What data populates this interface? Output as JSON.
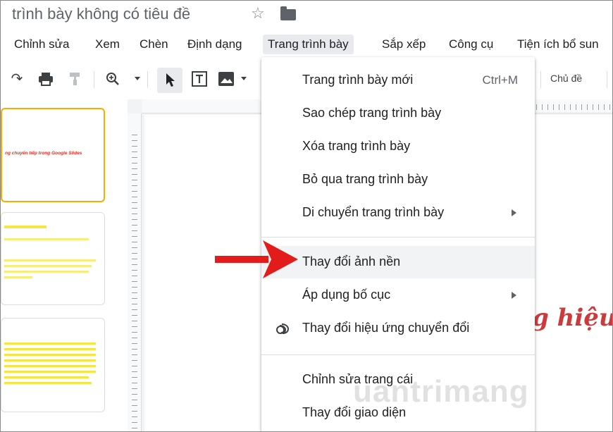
{
  "document": {
    "title": "trình bày không có tiêu đề"
  },
  "menubar": {
    "items": [
      {
        "label": "Chỉnh sửa"
      },
      {
        "label": "Xem"
      },
      {
        "label": "Chèn"
      },
      {
        "label": "Định dạng"
      },
      {
        "label": "Trang trình bày"
      },
      {
        "label": "Sắp xếp"
      },
      {
        "label": "Công cụ"
      },
      {
        "label": "Tiện ích bổ sun"
      }
    ],
    "active_index": 4
  },
  "toolbar": {
    "icons": [
      "redo-icon",
      "print-icon",
      "paint-format-icon",
      "zoom-icon",
      "select-icon",
      "textbox-icon",
      "image-icon"
    ],
    "theme_label": "Chủ đề"
  },
  "filmstrip": {
    "slides": [
      {
        "text": "ng chuyển tiếp trong Google Slides",
        "color": "#d93025"
      },
      {
        "text": "",
        "color": "#f5e642"
      },
      {
        "text": "",
        "color": "#f5e642"
      }
    ]
  },
  "slide": {
    "title_fragment": "g hiệu ứ"
  },
  "dropdown": {
    "items": [
      {
        "label": "Trang trình bày mới",
        "shortcut": "Ctrl+M"
      },
      {
        "label": "Sao chép trang trình bày"
      },
      {
        "label": "Xóa trang trình bày"
      },
      {
        "label": "Bỏ qua trang trình bày"
      },
      {
        "label": "Di chuyển trang trình bày",
        "submenu": true
      },
      {
        "label": "Thay đổi ảnh nền",
        "highlighted": true
      },
      {
        "label": "Áp dụng bố cục",
        "submenu": true
      },
      {
        "label": "Thay đổi hiệu ứng chuyển đổi",
        "icon": "transition-icon"
      },
      {
        "label": "Chỉnh sửa trang cái"
      },
      {
        "label": "Thay đổi giao diện"
      }
    ]
  },
  "watermark": {
    "text": "uantrimang"
  },
  "colors": {
    "accent_selected": "#f9ab00",
    "arrow_red": "#e21b1b",
    "slide_title": "#cc3b3b",
    "menu_hover": "#f1f3f4"
  }
}
